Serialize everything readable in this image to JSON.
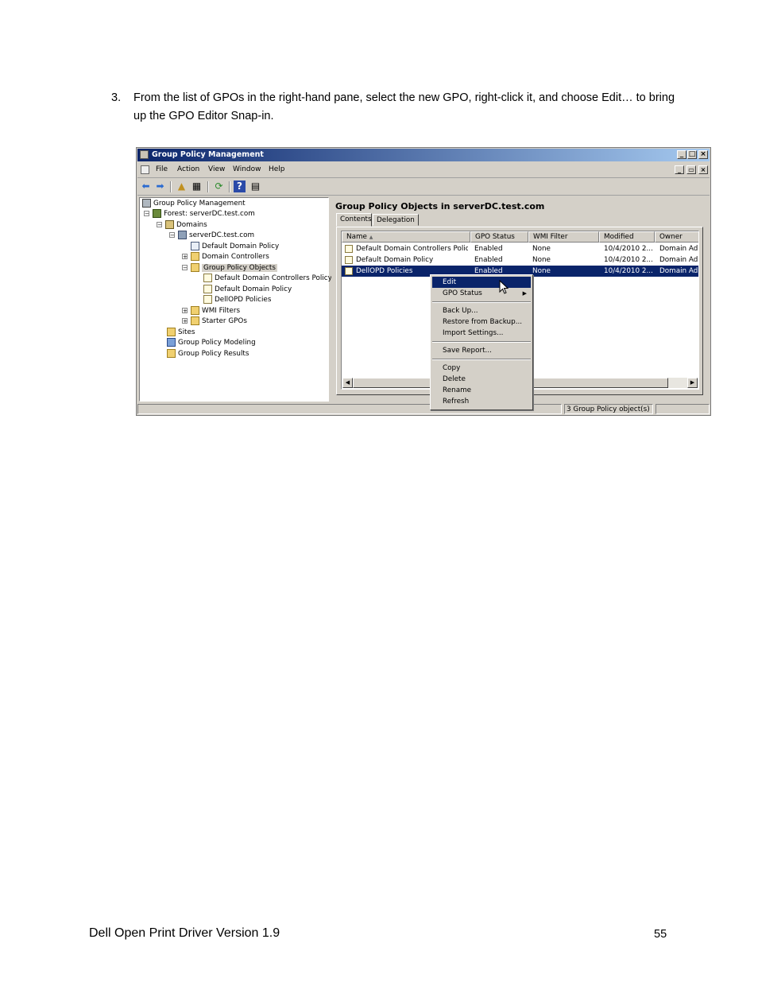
{
  "instruction": {
    "number": "3.",
    "text": "From the list of GPOs in the right-hand pane, select the new GPO, right-click it, and choose Edit… to bring up the GPO Editor Snap-in."
  },
  "window": {
    "title": "Group Policy Management",
    "menu": [
      "File",
      "Action",
      "View",
      "Window",
      "Help"
    ]
  },
  "tree": {
    "items": [
      {
        "label": "Group Policy Management"
      },
      {
        "label": "Forest: serverDC.test.com"
      },
      {
        "label": "Domains"
      },
      {
        "label": "serverDC.test.com"
      },
      {
        "label": "Default Domain Policy"
      },
      {
        "label": "Domain Controllers"
      },
      {
        "label": "Group Policy Objects"
      },
      {
        "label": "Default Domain Controllers Policy"
      },
      {
        "label": "Default Domain Policy"
      },
      {
        "label": "DellOPD Policies"
      },
      {
        "label": "WMI Filters"
      },
      {
        "label": "Starter GPOs"
      },
      {
        "label": "Sites"
      },
      {
        "label": "Group Policy Modeling"
      },
      {
        "label": "Group Policy Results"
      }
    ]
  },
  "content": {
    "title": "Group Policy Objects in serverDC.test.com",
    "tabs": [
      "Contents",
      "Delegation"
    ],
    "columns": [
      "Name",
      "GPO Status",
      "WMI Filter",
      "Modified",
      "Owner"
    ],
    "rows": [
      {
        "name": "Default Domain Controllers Policy",
        "status": "Enabled",
        "wmi": "None",
        "modified": "10/4/2010 2...",
        "owner": "Domain Adm"
      },
      {
        "name": "Default Domain Policy",
        "status": "Enabled",
        "wmi": "None",
        "modified": "10/4/2010 2...",
        "owner": "Domain Adm"
      },
      {
        "name": "DellOPD Policies",
        "status": "Enabled",
        "wmi": "None",
        "modified": "10/4/2010 2...",
        "owner": "Domain Adm"
      }
    ]
  },
  "context_menu": {
    "items": [
      "Edit",
      "GPO Status",
      "Back Up...",
      "Restore from Backup...",
      "Import Settings...",
      "Save Report...",
      "Copy",
      "Delete",
      "Rename",
      "Refresh"
    ]
  },
  "status_bar": {
    "count": "3 Group Policy object(s)"
  },
  "footer": {
    "doc_title": "Dell Open Print Driver Version 1.9",
    "page_number": "55"
  },
  "colors": {
    "selection": "#0a246a",
    "chrome": "#d4d0c8"
  }
}
